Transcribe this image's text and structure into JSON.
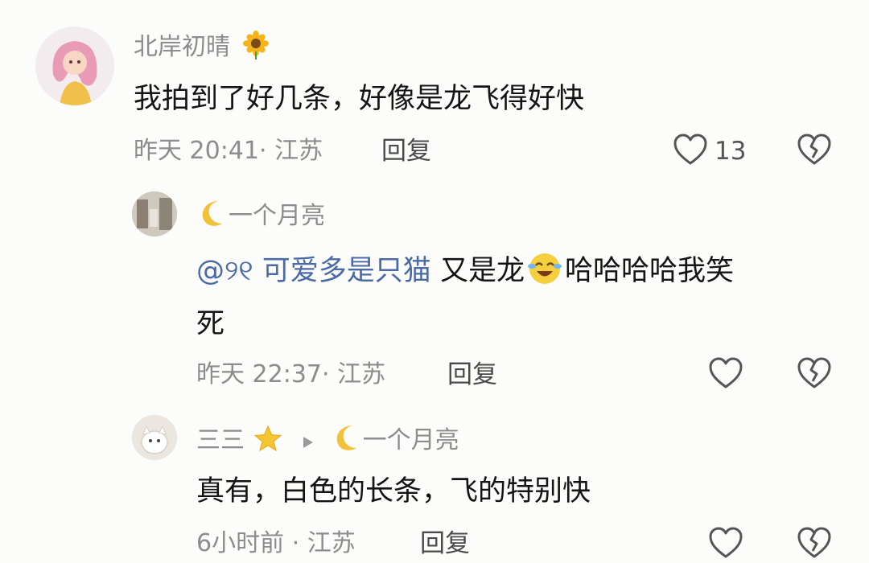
{
  "comments": [
    {
      "username": "北岸初晴",
      "username_emoji": "sunflower-icon",
      "text": "我拍到了好几条，好像是龙飞得好快",
      "time": "昨天 20:41",
      "location": "江苏",
      "reply_label": "回复",
      "like_count": "13",
      "replies": [
        {
          "username": "一个月亮",
          "username_prefix_emoji": "crescent-moon-icon",
          "mention": "@୨୧ 可爱多是只猫",
          "text_before_emoji": "又是龙",
          "text_emoji": "crying-laughing-face-icon",
          "text_after_emoji": "哈哈哈哈我笑",
          "text_line2": "死",
          "time": "昨天 22:37",
          "location": "江苏",
          "reply_label": "回复"
        },
        {
          "username": "三三",
          "username_emoji": "glowing-star-icon",
          "reply_to": "一个月亮",
          "reply_to_emoji": "crescent-moon-icon",
          "text": "真有，白色的长条，飞的特别快",
          "time": "6小时前",
          "location": "江苏",
          "reply_label": "回复"
        }
      ]
    }
  ],
  "colors": {
    "background": "#fcfcfa",
    "username": "#8c8c8c",
    "content": "#141414",
    "mention": "#4a6aa6",
    "meta": "#8c8c8c"
  }
}
